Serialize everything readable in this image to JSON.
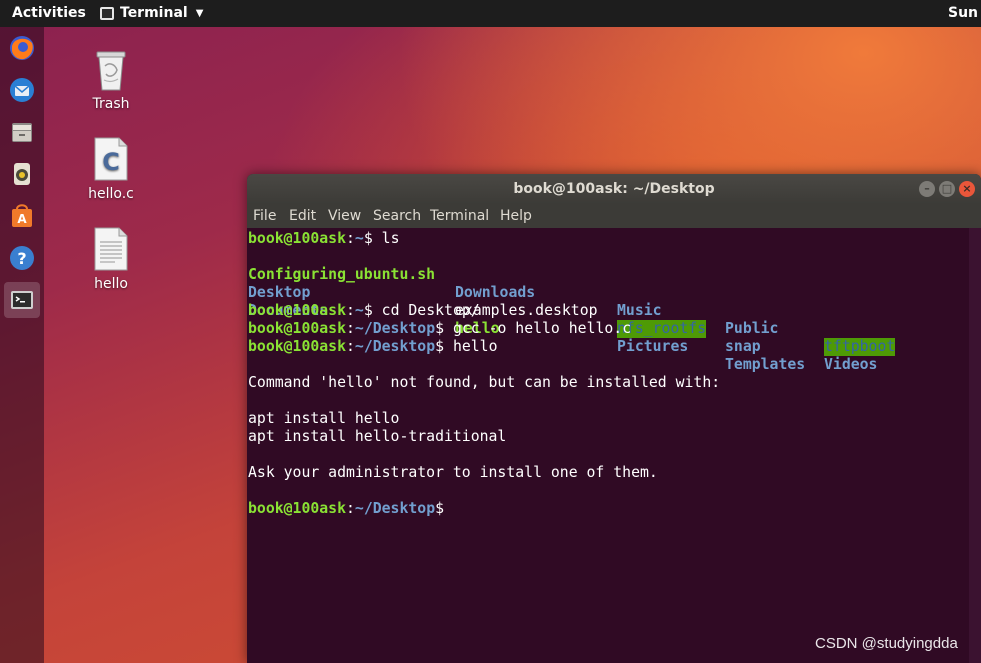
{
  "topbar": {
    "activities": "Activities",
    "app_menu": "Terminal",
    "clock": "Sun"
  },
  "dock": {
    "items": [
      {
        "name": "firefox",
        "icon": "firefox-icon"
      },
      {
        "name": "thunderbird",
        "icon": "thunderbird-icon"
      },
      {
        "name": "files",
        "icon": "files-icon"
      },
      {
        "name": "rhythmbox",
        "icon": "rhythmbox-icon"
      },
      {
        "name": "software",
        "icon": "software-center-icon"
      },
      {
        "name": "help",
        "icon": "help-icon"
      },
      {
        "name": "terminal",
        "icon": "terminal-icon",
        "active": true
      }
    ]
  },
  "desktop": {
    "icons": [
      {
        "label": "Trash",
        "icon": "trash-icon"
      },
      {
        "label": "hello.c",
        "icon": "c-source-file-icon"
      },
      {
        "label": "hello",
        "icon": "text-file-icon"
      }
    ]
  },
  "terminal": {
    "title": "book@100ask: ~/Desktop",
    "menu": [
      "File",
      "Edit",
      "View",
      "Search",
      "Terminal",
      "Help"
    ],
    "prompt_user": "book@100ask",
    "prompt_home": "~",
    "prompt_desktop": "~/Desktop",
    "cmd_ls": " ls",
    "cmd_cd": " cd Desktop/",
    "cmd_gcc": " gcc -o hello hello.c",
    "cmd_hello": " hello",
    "ls_entries": {
      "configuring": "Configuring_ubuntu.sh",
      "downloads": "Downloads",
      "music": "Music",
      "public": "Public",
      "tftpboot": "tftpboot",
      "desktop": "Desktop",
      "examples": "examples.desktop",
      "nfs_rootfs": "nfs_rootfs",
      "snap": "snap",
      "videos": "Videos",
      "documents": "Documents",
      "hello": "hello",
      "pictures": "Pictures",
      "templates": "Templates"
    },
    "output": {
      "not_found": "Command 'hello' not found, but can be installed with:",
      "apt1": "apt install hello",
      "apt2": "apt install hello-traditional",
      "ask": "Ask your administrator to install one of them."
    }
  },
  "watermark": "CSDN @studyingdda"
}
